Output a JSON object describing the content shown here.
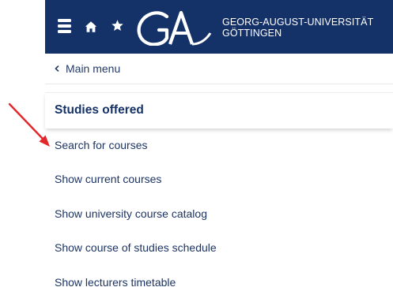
{
  "header": {
    "background_color": "#153268",
    "menu_icon": "hamburger-menu-icon",
    "home_icon": "home-icon",
    "favorites_icon": "star-icon",
    "logo": {
      "mark": "ga-monogram-logo",
      "line1": "GEORG-AUGUST-UNIVERSITÄT",
      "line2": "GÖTTINGEN"
    }
  },
  "navigation": {
    "back_icon": "chevron-left-icon",
    "back_label": "Main menu"
  },
  "section": {
    "title": "Studies offered",
    "items": [
      {
        "label": "Search for courses"
      },
      {
        "label": "Show current courses"
      },
      {
        "label": "Show university course catalog"
      },
      {
        "label": "Show course of studies schedule"
      },
      {
        "label": "Show lecturers timetable"
      }
    ]
  },
  "annotation": {
    "type": "arrow",
    "color": "#e3262a",
    "points_to": "Search for courses"
  },
  "colors": {
    "text_link": "#1c3464",
    "section_title": "#153268"
  }
}
